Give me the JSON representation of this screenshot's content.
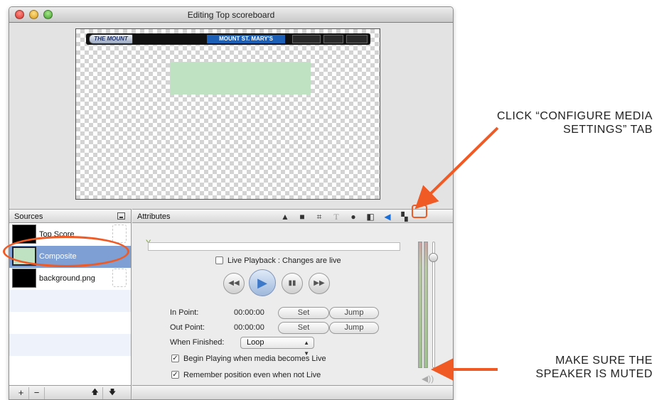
{
  "window": {
    "title": "Editing Top scoreboard"
  },
  "preview": {
    "logo_text": "THE MOUNT",
    "team_text": "MOUNT ST. MARY'S"
  },
  "sources": {
    "header": "Sources",
    "items": [
      {
        "label": "Top Score",
        "selected": false
      },
      {
        "label": "Composite",
        "selected": true
      },
      {
        "label": "background.png",
        "selected": false
      }
    ],
    "footer": {
      "add": "+",
      "remove": "−",
      "up": "🡅",
      "down": "🡇"
    }
  },
  "attributes": {
    "header": "Attributes",
    "tabs": [
      "layers-icon",
      "folder-icon",
      "crop-icon",
      "text-icon",
      "person-icon",
      "split-icon",
      "speaker-icon",
      "checker-icon"
    ],
    "active_tab": "speaker-icon",
    "live_playback_label": "Live Playback : Changes are live",
    "in_point_label": "In Point:",
    "in_point_value": "00:00:00",
    "out_point_label": "Out Point:",
    "out_point_value": "00:00:00",
    "set_label": "Set",
    "jump_label": "Jump",
    "when_finished_label": "When Finished:",
    "when_finished_value": "Loop",
    "begin_playing_label": "Begin Playing when media becomes Live",
    "remember_position_label": "Remember position even when not Live"
  },
  "annotations": {
    "click_tab": [
      "CLICK “CONFIGURE MEDIA",
      "SETTINGS” TAB"
    ],
    "speaker_muted": [
      "MAKE SURE THE",
      "SPEAKER IS MUTED"
    ],
    "accent_color": "#ef5a25"
  }
}
